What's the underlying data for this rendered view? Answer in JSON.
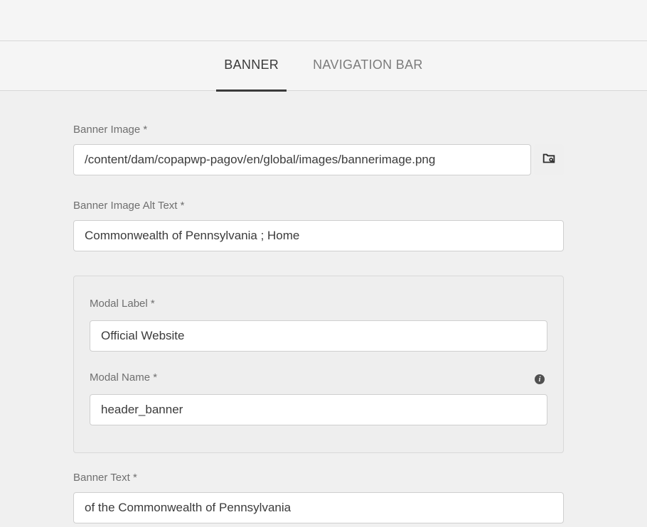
{
  "tabs": {
    "banner": "BANNER",
    "navigation": "NAVIGATION BAR"
  },
  "fields": {
    "bannerImage": {
      "label": "Banner Image *",
      "value": "/content/dam/copapwp-pagov/en/global/images/bannerimage.png"
    },
    "bannerImageAlt": {
      "label": "Banner Image Alt Text *",
      "value": "Commonwealth of Pennsylvania ; Home"
    },
    "modalLabel": {
      "label": "Modal Label *",
      "value": "Official Website"
    },
    "modalName": {
      "label": "Modal Name *",
      "value": "header_banner"
    },
    "bannerText": {
      "label": "Banner Text *",
      "value": "of the Commonwealth of Pennsylvania"
    }
  }
}
